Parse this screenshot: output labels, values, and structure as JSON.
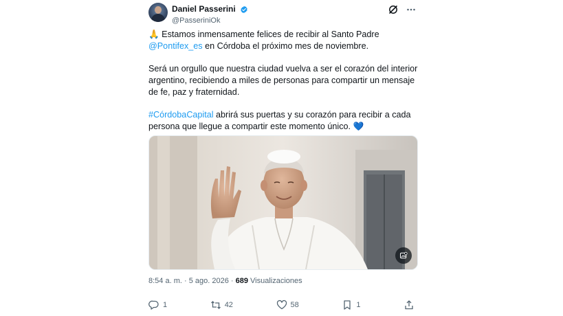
{
  "author": {
    "display_name": "Daniel Passerini",
    "handle": "@PasseriniOk"
  },
  "tweet": {
    "line1_emoji": "🙏",
    "line1_text": " Estamos inmensamente felices de recibir al Santo Padre",
    "mention": "@Pontifex_es",
    "line2_text": " en Córdoba el próximo mes de noviembre.",
    "paragraph2": "Será un orgullo que nuestra ciudad vuelva a ser el corazón del interior argentino, recibiendo a miles de personas para compartir un mensaje de fe, paz y fraternidad.",
    "hashtag": "#CórdobaCapital",
    "paragraph3_text": " abrirá sus puertas y su corazón para recibir a cada persona que llegue a compartir este momento único. ",
    "heart_emoji": "💙"
  },
  "meta": {
    "time": "8:54 a. m.",
    "separator": " · ",
    "date": "5 ago. 2026",
    "views_count": "689",
    "views_label": " Visualizaciones"
  },
  "actions": {
    "replies": "1",
    "reposts": "42",
    "likes": "58",
    "bookmarks": "1"
  },
  "colors": {
    "link": "#1d9bf0",
    "verified": "#1d9bf0",
    "secondary_text": "#536471"
  }
}
